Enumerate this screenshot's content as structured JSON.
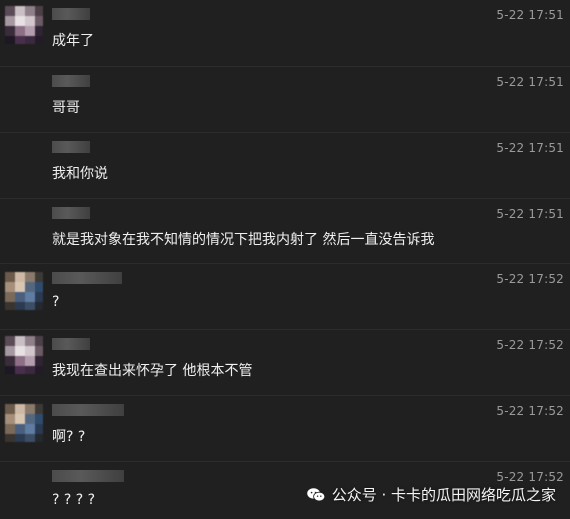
{
  "messages": [
    {
      "time": "5-22 17:51",
      "text": "成年了",
      "avatar": "avatar-a"
    },
    {
      "time": "5-22 17:51",
      "text": "哥哥",
      "avatar": ""
    },
    {
      "time": "5-22 17:51",
      "text": "我和你说",
      "avatar": ""
    },
    {
      "time": "5-22 17:51",
      "text": "就是我对象在我不知情的情况下把我内射了 然后一直没告诉我",
      "avatar": ""
    },
    {
      "time": "5-22 17:52",
      "text": "?",
      "avatar": "avatar-b"
    },
    {
      "time": "5-22 17:52",
      "text": "我现在查出来怀孕了 他根本不管",
      "avatar": "avatar-a"
    },
    {
      "time": "5-22 17:52",
      "text": "啊? ?",
      "avatar": "avatar-b"
    },
    {
      "time": "5-22 17:52",
      "text": "? ? ? ?",
      "avatar": ""
    }
  ],
  "watermark": {
    "text": "公众号 · 卡卡的瓜田网络吃瓜之家",
    "icon": "wechat-icon"
  },
  "colors": {
    "background": "#202020",
    "text": "#f0f0f0",
    "timestamp": "#9a9a9a"
  }
}
